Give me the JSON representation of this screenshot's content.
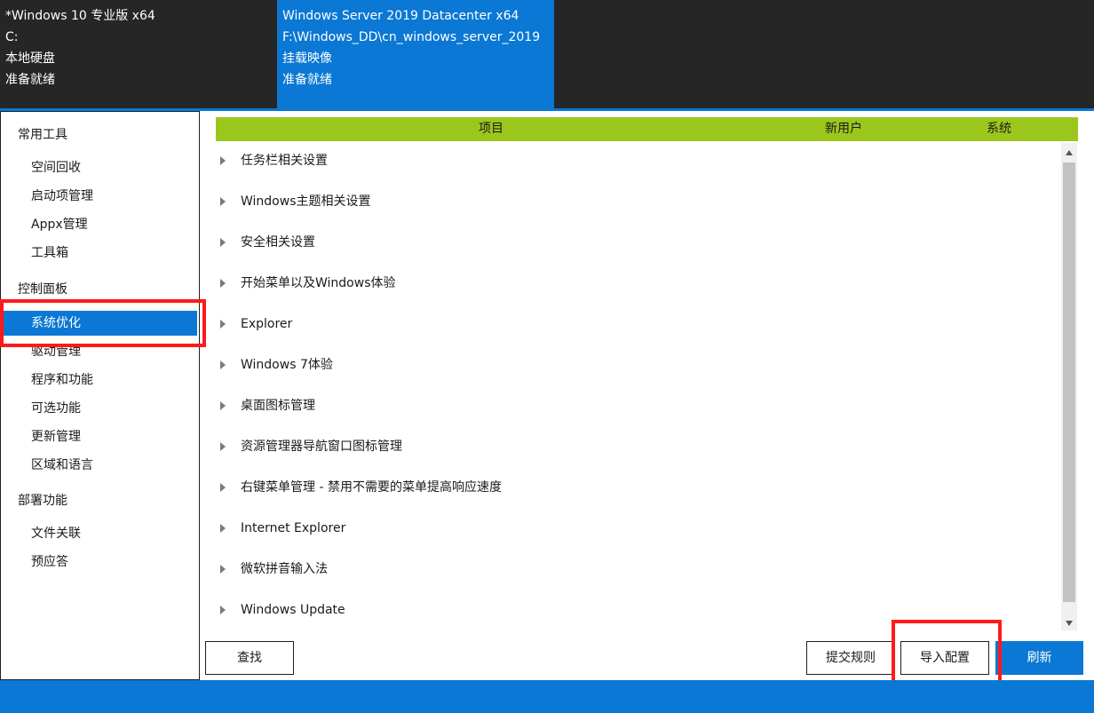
{
  "images": [
    {
      "title": "*Windows 10 专业版 x64",
      "path": "C:",
      "type": "本地硬盘",
      "status": "准备就绪"
    },
    {
      "title": "Windows Server 2019 Datacenter x64",
      "path": "F:\\Windows_DD\\cn_windows_server_2019",
      "type": "挂载映像",
      "status": "准备就绪"
    }
  ],
  "sidebar": {
    "groups": [
      {
        "label": "常用工具",
        "items": [
          "空间回收",
          "启动项管理",
          "Appx管理",
          "工具箱"
        ]
      },
      {
        "label": "控制面板",
        "items": [
          "系统优化",
          "驱动管理",
          "程序和功能",
          "可选功能",
          "更新管理",
          "区域和语言"
        ]
      },
      {
        "label": "部署功能",
        "items": [
          "文件关联",
          "预应答"
        ]
      }
    ],
    "active": "系统优化"
  },
  "table": {
    "headers": {
      "item": "项目",
      "new_user": "新用户",
      "system": "系统"
    },
    "rows": [
      "任务栏相关设置",
      "Windows主题相关设置",
      "安全相关设置",
      "开始菜单以及Windows体验",
      "Explorer",
      "Windows 7体验",
      "桌面图标管理",
      "资源管理器导航窗口图标管理",
      "右键菜单管理 - 禁用不需要的菜单提高响应速度",
      "Internet Explorer",
      "微软拼音输入法",
      "Windows Update"
    ]
  },
  "buttons": {
    "find": "查找",
    "submit_rules": "提交规则",
    "import_config": "导入配置",
    "refresh": "刷新"
  },
  "colors": {
    "accent": "#0a78d4",
    "header_green": "#9bc71d",
    "highlight_red": "#ff1a1a",
    "dark_panel": "#262626"
  }
}
